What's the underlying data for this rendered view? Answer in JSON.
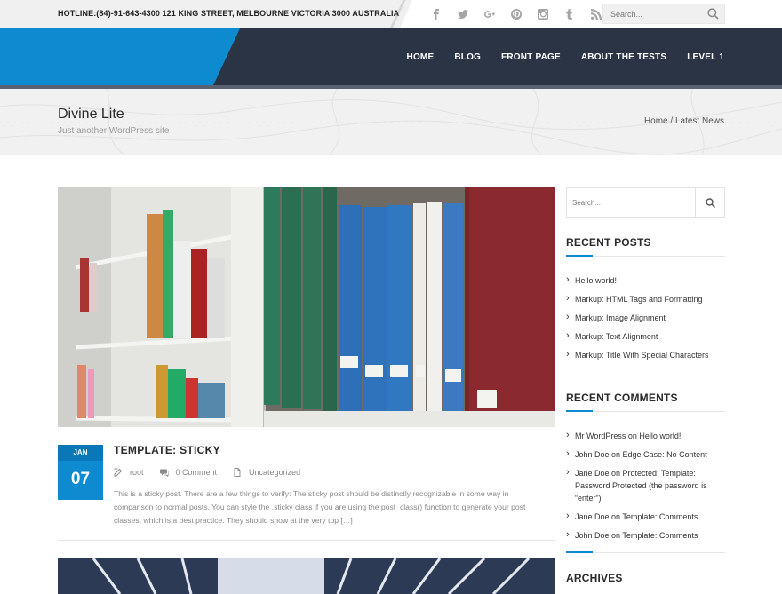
{
  "topbar": {
    "hotline": "HOTLINE:(84)-91-643-4300 121 KING STREET, MELBOURNE VICTORIA 3000 AUSTRALIA",
    "social_icons": [
      "facebook-icon",
      "twitter-icon",
      "google-plus-icon",
      "pinterest-icon",
      "instagram-icon",
      "tumblr-icon",
      "rss-icon"
    ],
    "search_placeholder": "Search..."
  },
  "nav": {
    "items": [
      "HOME",
      "BLOG",
      "FRONT PAGE",
      "ABOUT THE TESTS",
      "LEVEL 1"
    ]
  },
  "banner": {
    "site_title": "Divine Lite",
    "tagline": "Just another WordPress site",
    "breadcrumb_home": "Home",
    "breadcrumb_sep": " / ",
    "breadcrumb_current": "Latest News"
  },
  "post": {
    "date_month": "JAN",
    "date_day": "07",
    "title": "TEMPLATE: STICKY",
    "author": "root",
    "comments": "0 Comment",
    "category": "Uncategorized",
    "excerpt": "This is a sticky post. There are a few things to verify: The sticky post should be distinctly recognizable in some way in comparison to normal posts. You can style the .sticky class if you are using the post_class() function to generate your post classes, which is a best practice. They should show at the very top […]"
  },
  "sidebar": {
    "search_placeholder": "Search...",
    "recent_posts_title": "RECENT POSTS",
    "recent_posts": [
      "Hello world!",
      "Markup: HTML Tags and Formatting",
      "Markup: Image Alignment",
      "Markup: Text Alignment",
      "Markup: Title With Special Characters"
    ],
    "recent_comments_title": "RECENT COMMENTS",
    "recent_comments": [
      "Mr WordPress on Hello world!",
      "John Doe on Edge Case: No Content",
      "Jane Doe on Protected: Template: Password Protected (the password is “enter”)",
      "Jane Doe on Template: Comments",
      "John Doe on Template: Comments"
    ],
    "archives_title": "ARCHIVES"
  },
  "colors": {
    "accent": "#0e8ad0",
    "header_dark": "#2b3445",
    "banner_bg": "#f1f1f1"
  }
}
